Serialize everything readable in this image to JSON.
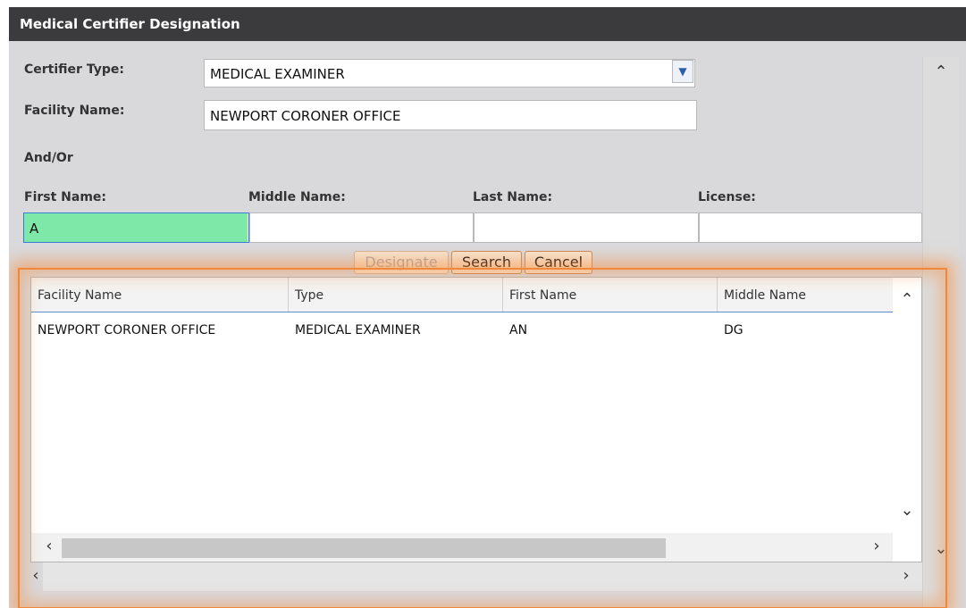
{
  "dialog": {
    "title": "Medical Certifier Designation"
  },
  "form": {
    "certifier_type_label": "Certifier Type:",
    "certifier_type_value": "MEDICAL EXAMINER",
    "facility_name_label": "Facility Name:",
    "facility_name_value": "NEWPORT CORONER OFFICE",
    "and_or_label": "And/Or",
    "first_name_label": "First Name:",
    "first_name_value": "A",
    "middle_name_label": "Middle Name:",
    "middle_name_value": "",
    "last_name_label": "Last Name:",
    "last_name_value": "",
    "license_label": "License:",
    "license_value": ""
  },
  "buttons": {
    "designate": "Designate",
    "search": "Search",
    "cancel": "Cancel"
  },
  "results": {
    "columns": [
      "Facility Name",
      "Type",
      "First Name",
      "Middle Name"
    ],
    "rows": [
      [
        "NEWPORT CORONER OFFICE",
        "MEDICAL EXAMINER",
        "AN",
        "DG"
      ]
    ]
  },
  "icons": {
    "dropdown": "chevron-down-icon",
    "scroll_up": "chevron-up-icon",
    "scroll_down": "chevron-down-icon",
    "scroll_left": "chevron-left-icon",
    "scroll_right": "chevron-right-icon"
  },
  "colors": {
    "highlight": "#f0883c",
    "input_active": "#7de8a8",
    "titlebar": "#3b3b3d"
  }
}
